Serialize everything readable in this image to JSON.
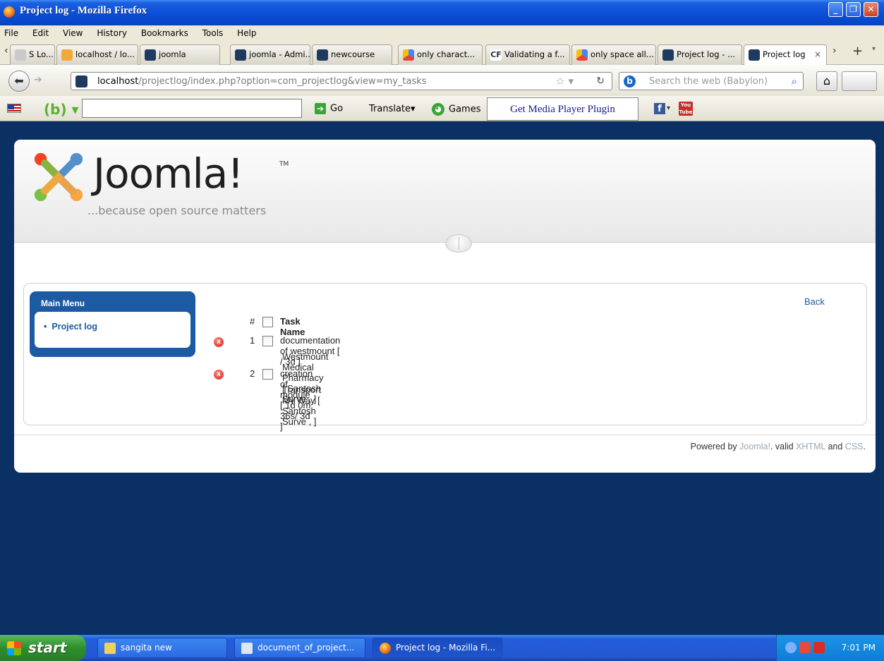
{
  "window": {
    "title": "Project log - Mozilla Firefox"
  },
  "menu": [
    "File",
    "Edit",
    "View",
    "History",
    "Bookmarks",
    "Tools",
    "Help"
  ],
  "tabs": [
    {
      "label": "S Lo...",
      "icon": "site-icon"
    },
    {
      "label": "localhost / lo...",
      "icon": "phpmyadmin-icon"
    },
    {
      "label": "joomla",
      "icon": "joomla-icon"
    },
    {
      "label": "joomla - Admi...",
      "icon": "joomla-icon"
    },
    {
      "label": "newcourse",
      "icon": "joomla-icon"
    },
    {
      "label": "only charact...",
      "icon": "google-icon"
    },
    {
      "label": "Validating a f...",
      "icon": "cf-icon"
    },
    {
      "label": "only space all...",
      "icon": "google-icon"
    },
    {
      "label": "Project log - ...",
      "icon": "joomla-icon"
    },
    {
      "label": "Project log",
      "icon": "joomla-icon",
      "active": true
    }
  ],
  "nav": {
    "url_host": "localhost",
    "url_path": "/projectlog/index.php?option=com_projectlog&view=my_tasks",
    "search_placeholder": "Search the web (Babylon)"
  },
  "toolbar": {
    "input_value": "",
    "go_label": "Go",
    "translate_label": "Translate",
    "games_label": "Games",
    "media_label": "Get Media Player Plugin",
    "youtube_label": "You Tube"
  },
  "site": {
    "logo_text": "Joomla!",
    "tm": "TM",
    "tagline": "...because open source matters",
    "menu_title": "Main Menu",
    "menu_items": [
      "Project log"
    ],
    "back_label": "Back",
    "header_hash": "#",
    "header_name": "Task Name",
    "tasks": [
      {
        "num": "1",
        "name": "documentation of westmount [ / 3d ]",
        "project": "Westmount Medical Pharmacy [ Santosh Surve , ]"
      },
      {
        "num": "2",
        "name": "creation of module [ 1d 0m 36s/ 3d ]",
        "project": "Transport My Way [ Santosh Surve , ]"
      }
    ],
    "footer_prefix": "Powered by",
    "footer_joomla": "Joomla!",
    "footer_mid": ". valid",
    "footer_xhtml": "XHTML",
    "footer_and": "and",
    "footer_css": "CSS",
    "footer_end": "."
  },
  "taskbar": {
    "start_label": "start",
    "items": [
      "sangita new",
      "document_of_project...",
      "Project log - Mozilla Fi..."
    ],
    "clock": "7:01 PM"
  }
}
